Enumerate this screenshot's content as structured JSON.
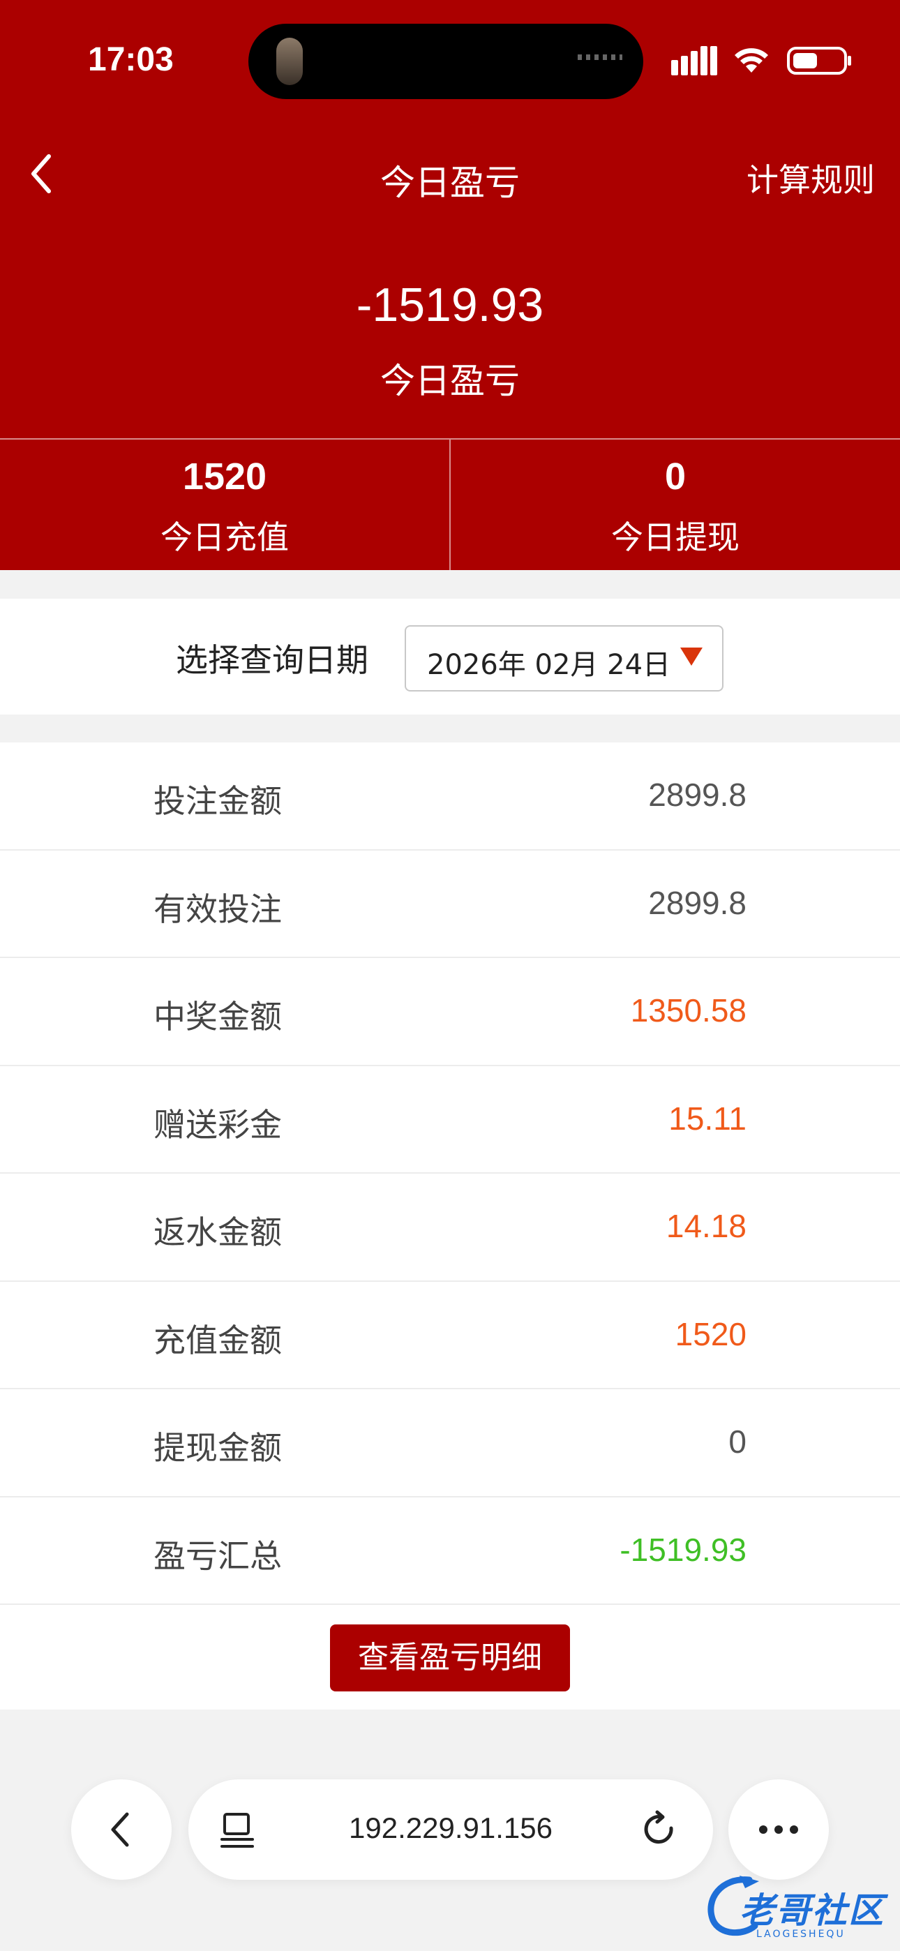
{
  "status_bar": {
    "time": "17:03"
  },
  "colors": {
    "brand_red": "#ab0000",
    "orange": "#f05a1a",
    "green": "#3fbf25"
  },
  "nav": {
    "title": "今日盈亏",
    "rule_label": "计算规则",
    "back_icon": "chevron-left-icon"
  },
  "hero": {
    "amount": "-1519.93",
    "label": "今日盈亏"
  },
  "stats": [
    {
      "value": "1520",
      "label": "今日充值"
    },
    {
      "value": "0",
      "label": "今日提现"
    }
  ],
  "date_filter": {
    "label": "选择查询日期",
    "value": "2026年 02月 24日"
  },
  "details": [
    {
      "label": "投注金额",
      "value": "2899.8"
    },
    {
      "label": "有效投注",
      "value": "2899.8"
    },
    {
      "label": "中奖金额",
      "value": "1350.58"
    },
    {
      "label": "赠送彩金",
      "value": "15.11"
    },
    {
      "label": "返水金额",
      "value": "14.18"
    },
    {
      "label": "充值金额",
      "value": "1520"
    },
    {
      "label": "提现金额",
      "value": "0"
    },
    {
      "label": "盈亏汇总",
      "value": "-1519.93"
    }
  ],
  "detail_button": "查看盈亏明细",
  "browser": {
    "url": "192.229.91.156"
  },
  "watermark": {
    "title": "老哥社区",
    "subtitle": "LAOGESHEQU"
  }
}
